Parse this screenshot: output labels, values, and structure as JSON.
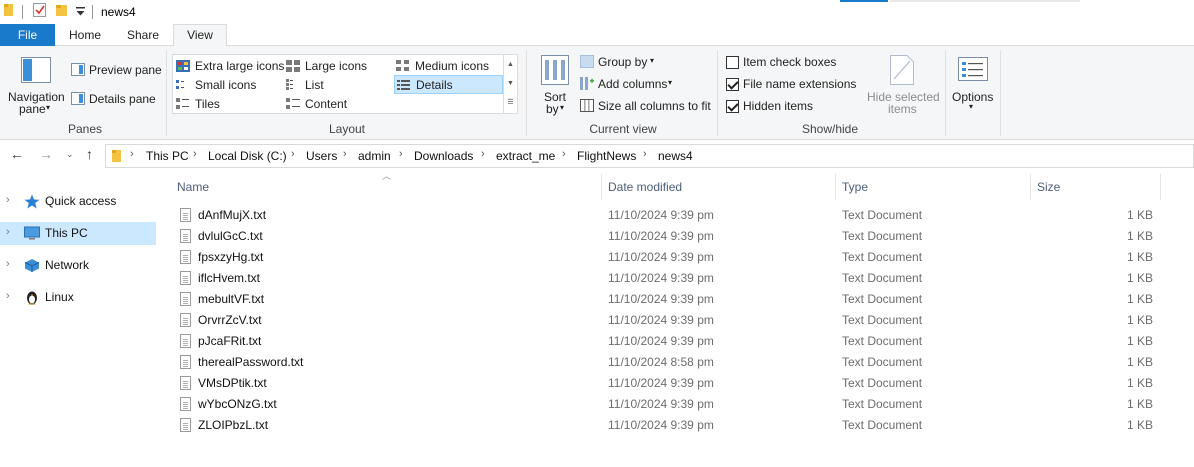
{
  "window": {
    "title": "news4"
  },
  "colors": {
    "accent": "#1979ca",
    "selection": "#cce8ff",
    "column_header_text": "#4c607a"
  },
  "tabs": [
    {
      "label": "File"
    },
    {
      "label": "Home"
    },
    {
      "label": "Share"
    },
    {
      "label": "View"
    }
  ],
  "ribbon": {
    "panes": {
      "navigation_pane": "Navigation",
      "navigation_pane_2": "pane",
      "preview_pane": "Preview pane",
      "details_pane": "Details pane",
      "group": "Panes"
    },
    "layout": {
      "items": [
        "Extra large icons",
        "Large icons",
        "Medium icons",
        "Small icons",
        "List",
        "Details",
        "Tiles",
        "Content"
      ],
      "selected": "Details",
      "group": "Layout"
    },
    "current_view": {
      "sort_by_1": "Sort",
      "sort_by_2": "by",
      "group_by": "Group by",
      "add_columns": "Add columns",
      "size_all_columns": "Size all columns to fit",
      "group": "Current view"
    },
    "show_hide": {
      "item_check_boxes": "Item check boxes",
      "item_check_boxes_checked": false,
      "file_name_extensions": "File name extensions",
      "file_name_extensions_checked": true,
      "hidden_items": "Hidden items",
      "hidden_items_checked": true,
      "hide_selected_1": "Hide selected",
      "hide_selected_2": "items",
      "group": "Show/hide"
    },
    "options": {
      "label": "Options"
    }
  },
  "breadcrumb": [
    "This PC",
    "Local Disk (C:)",
    "Users",
    "admin",
    "Downloads",
    "extract_me",
    "FlightNews",
    "news4"
  ],
  "sidebar": {
    "items": [
      {
        "label": "Quick access",
        "icon": "star-icon",
        "selected": false
      },
      {
        "label": "This PC",
        "icon": "computer-icon",
        "selected": true
      },
      {
        "label": "Network",
        "icon": "network-icon",
        "selected": false
      },
      {
        "label": "Linux",
        "icon": "penguin-icon",
        "selected": false
      }
    ]
  },
  "columns": {
    "name": "Name",
    "date": "Date modified",
    "type": "Type",
    "size": "Size"
  },
  "files": [
    {
      "name": "dAnfMujX.txt",
      "date": "11/10/2024 9:39 pm",
      "type": "Text Document",
      "size": "1 KB"
    },
    {
      "name": "dvlulGcC.txt",
      "date": "11/10/2024 9:39 pm",
      "type": "Text Document",
      "size": "1 KB"
    },
    {
      "name": "fpsxzyHg.txt",
      "date": "11/10/2024 9:39 pm",
      "type": "Text Document",
      "size": "1 KB"
    },
    {
      "name": "iflcHvem.txt",
      "date": "11/10/2024 9:39 pm",
      "type": "Text Document",
      "size": "1 KB"
    },
    {
      "name": "mebultVF.txt",
      "date": "11/10/2024 9:39 pm",
      "type": "Text Document",
      "size": "1 KB"
    },
    {
      "name": "OrvrrZcV.txt",
      "date": "11/10/2024 9:39 pm",
      "type": "Text Document",
      "size": "1 KB"
    },
    {
      "name": "pJcaFRit.txt",
      "date": "11/10/2024 9:39 pm",
      "type": "Text Document",
      "size": "1 KB"
    },
    {
      "name": "therealPassword.txt",
      "date": "11/10/2024 8:58 pm",
      "type": "Text Document",
      "size": "1 KB"
    },
    {
      "name": "VMsDPtik.txt",
      "date": "11/10/2024 9:39 pm",
      "type": "Text Document",
      "size": "1 KB"
    },
    {
      "name": "wYbcONzG.txt",
      "date": "11/10/2024 9:39 pm",
      "type": "Text Document",
      "size": "1 KB"
    },
    {
      "name": "ZLOIPbzL.txt",
      "date": "11/10/2024 9:39 pm",
      "type": "Text Document",
      "size": "1 KB"
    }
  ]
}
